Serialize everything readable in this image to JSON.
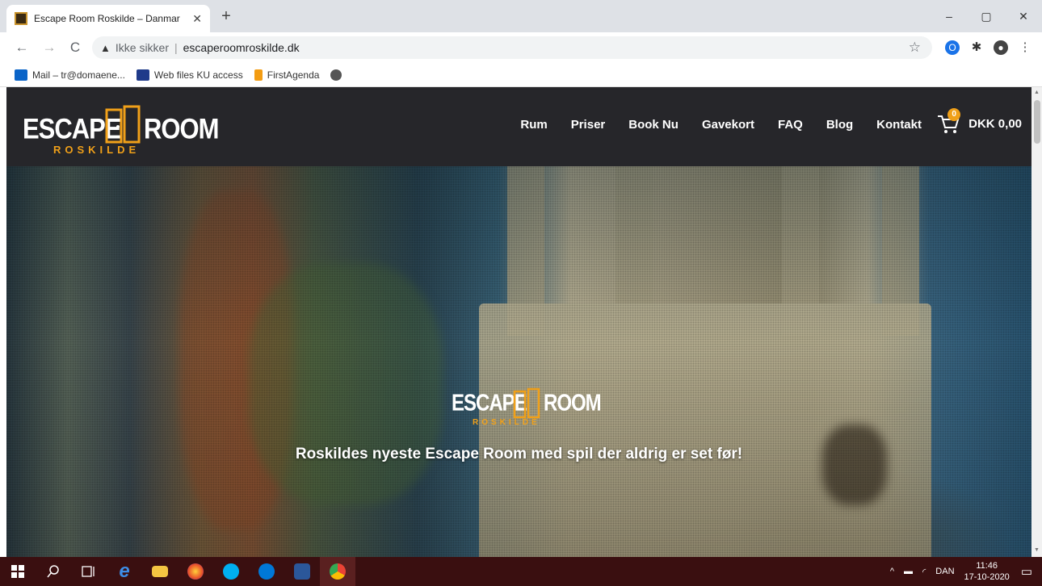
{
  "browser": {
    "tab_title": "Escape Room Roskilde – Danmar",
    "tab_close": "✕",
    "new_tab": "+",
    "nav_back": "←",
    "nav_forward": "→",
    "nav_reload": "C",
    "security_warning": "▲",
    "not_secure_label": "Ikke sikker",
    "url": "escaperoomroskilde.dk",
    "window_controls": [
      "–",
      "▢",
      "✕"
    ]
  },
  "bookmarks": [
    {
      "label": "Mail – tr@domaene...",
      "icon": "outlook-icon",
      "color": "#0a64c8"
    },
    {
      "label": "Web files KU access",
      "icon": "ku-icon",
      "color": "#1f3a8a"
    },
    {
      "label": "FirstAgenda",
      "icon": "firstagenda-icon",
      "color": "#f39c12"
    },
    {
      "label": "",
      "icon": "globe-icon",
      "color": "#555555"
    }
  ],
  "site": {
    "logo": {
      "word_left": "ESCAPE",
      "word_right": "ROOM",
      "sub": "ROSKILDE"
    },
    "nav": [
      "Rum",
      "Priser",
      "Book Nu",
      "Gavekort",
      "FAQ",
      "Blog",
      "Kontakt"
    ],
    "cart": {
      "count": "0",
      "total": "DKK 0,00"
    },
    "hero": {
      "logo": {
        "word_left": "ESCAPE",
        "word_right": "ROOM",
        "sub": "ROSKILDE"
      },
      "tagline": "Roskildes nyeste Escape Room med spil der aldrig er set før!"
    },
    "colors": {
      "header_bg": "#26262a",
      "accent": "#f0a019"
    }
  },
  "taskbar": {
    "apps": [
      "windows-start-icon",
      "search-icon",
      "task-view-icon",
      "edge-icon",
      "file-explorer-icon",
      "firefox-icon",
      "skype-icon",
      "skype-for-business-icon",
      "word-icon",
      "chrome-icon"
    ],
    "language": "DAN",
    "time": "11:46",
    "date": "17-10-2020"
  }
}
